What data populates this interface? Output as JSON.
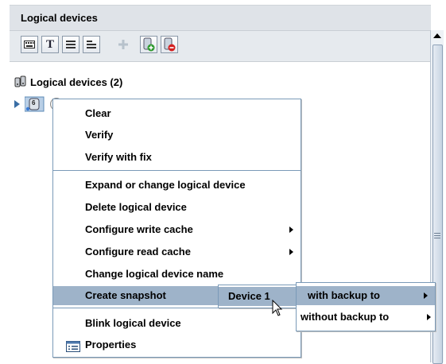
{
  "panel": {
    "title": "Logical devices"
  },
  "toolbar": {
    "buttons": [
      {
        "icon": "keyboard-icon"
      },
      {
        "icon": "text-icon",
        "glyph": "T"
      },
      {
        "icon": "list-view-icon"
      },
      {
        "icon": "details-view-icon"
      },
      {
        "icon": "add-icon"
      },
      {
        "icon": "add-device-icon"
      },
      {
        "icon": "remove-device-icon"
      }
    ]
  },
  "tree": {
    "root_label": "Logical devices (2)",
    "node_badge": "6"
  },
  "context_menu": {
    "items": [
      "Clear",
      "Verify",
      "Verify with fix",
      "Expand or change logical device",
      "Delete logical device",
      "Configure write cache",
      "Configure read cache",
      "Change logical device name",
      "Create snapshot",
      "Blink logical device",
      "Properties"
    ]
  },
  "submenu1": {
    "items": [
      "Device 1"
    ]
  },
  "submenu2": {
    "items": [
      "with backup to",
      "without backup to"
    ]
  },
  "colors": {
    "highlight": "#9eb3c9",
    "menu_border": "#7a9ab8",
    "header_bg": "#dfe3e8"
  }
}
